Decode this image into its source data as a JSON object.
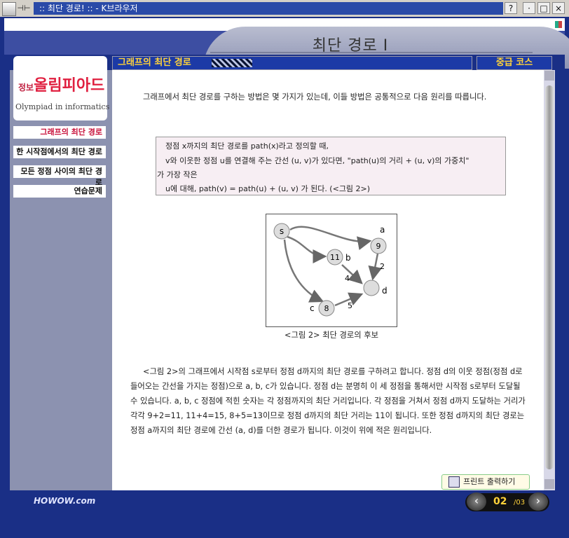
{
  "window": {
    "title": ":: 최단 경로! :: - K브라우저",
    "pin_symbol": "⊣⊢",
    "help_label": "?",
    "minimize_label": "·",
    "maximize_label": "□",
    "close_label": "×"
  },
  "header": {
    "page_title": "최단 경로 I",
    "section_title": "그래프의 최단 경로",
    "course_badge": "중급 코스"
  },
  "sidebar": {
    "logo_small": "정보",
    "logo_main": "올림피아드",
    "logo_en": "Olympiad in informatics",
    "items": [
      {
        "label": "그래프의 최단 경로"
      },
      {
        "label": "한 시작점에서의 최단 경로"
      },
      {
        "label": "모든 정점 사이의 최단 경로"
      },
      {
        "label": "연습문제"
      }
    ],
    "brand": "HOWOW.com"
  },
  "content": {
    "intro": "그래프에서 최단 경로를 구하는 방법은 몇 가지가 있는데, 이들 방법은 공통적으로 다음 원리를 따릅니다.",
    "rule_lines": [
      "정점 x까지의 최단 경로를 path(x)라고 정의할 때,",
      "v와 이웃한 정점 u를 연결해 주는 간선 (u, v)가 있다면, \"path(u)의 거리 + (u, v)의 가중치\"",
      "가 가장 작은",
      "u에 대해, path(v) = path(u) + (u, v) 가 된다. (<그림 2>)"
    ],
    "figure": {
      "caption": "<그림 2> 최단 경로의 후보",
      "nodes": {
        "s": "s",
        "n9": "9",
        "n11": "11",
        "n8": "8"
      },
      "labels": {
        "a": "a",
        "b": "b",
        "c": "c",
        "d": "d"
      },
      "weights": {
        "ad": "2",
        "bd": "4",
        "cd": "5"
      }
    },
    "body": "<그림 2>의 그래프에서 시작점 s로부터 정점 d까지의 최단 경로를 구하려고 합니다. 정점 d의 이웃 정점(정점 d로 들어오는 간선을 가지는 정점)으로 a, b, c가 있습니다. 정점 d는 분명히 이 세 정점을 통해서만 시작점 s로부터 도달될 수 있습니다. a, b, c 정점에 적힌 숫자는 각 정점까지의 최단 거리입니다. 각 정점을 거쳐서 정점 d까지 도달하는 거리가 각각 9+2=11, 11+4=15, 8+5=13이므로 정점 d까지의 최단 거리는 11이 됩니다. 또한 정점 d까지의 최단 경로는 정점 a까지의 최단 경로에 간선 (a, d)를 더한 경로가 됩니다. 이것이 위에 적은 원리입니다.",
    "print_label": "프린트 출력하기"
  },
  "pager": {
    "current": "02",
    "total": "/03",
    "prev_label": "‹",
    "next_label": "›"
  }
}
